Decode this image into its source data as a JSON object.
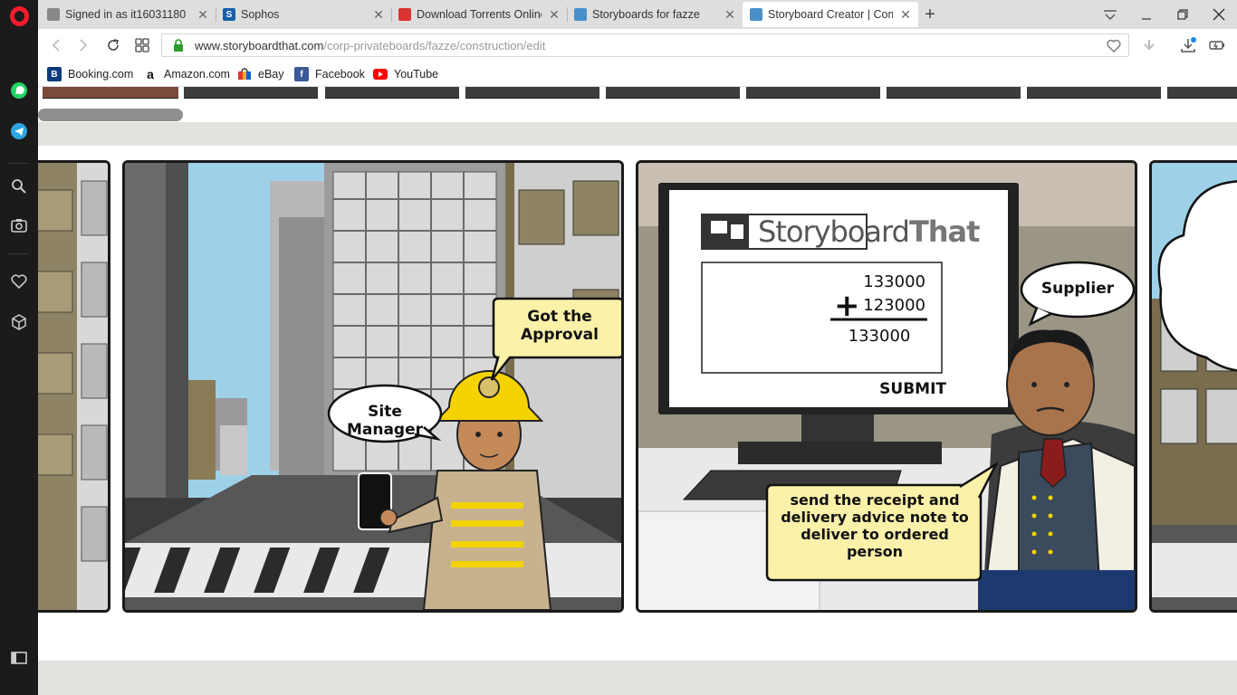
{
  "browser": {
    "tabs": [
      {
        "title": "Signed in as it16031180",
        "favicon": "doc-icon"
      },
      {
        "title": "Sophos",
        "favicon": "sophos-icon"
      },
      {
        "title": "Download Torrents Online",
        "favicon": "torrent-icon"
      },
      {
        "title": "Storyboards for fazze",
        "favicon": "storyboard-icon"
      },
      {
        "title": "Storyboard Creator | Comi",
        "favicon": "storyboard-icon",
        "active": true
      }
    ],
    "url_host": "www.storyboardthat.com",
    "url_path": "/corp-privateboards/fazze/construction/edit",
    "bookmarks": [
      {
        "label": "Booking.com",
        "icon": "B",
        "color": "#0c3b7c"
      },
      {
        "label": "Amazon.com",
        "icon": "a",
        "color": "#111111"
      },
      {
        "label": "eBay",
        "icon": "shop",
        "color": "#e53238"
      },
      {
        "label": "Facebook",
        "icon": "f",
        "color": "#3b5998"
      },
      {
        "label": "YouTube",
        "icon": "play",
        "color": "#ff0000"
      }
    ]
  },
  "storyboard": {
    "cell1": {
      "approval_bubble": "Got the Approval",
      "name_bubble": "Site Manager"
    },
    "cell2": {
      "brand_light": "Storyboard",
      "brand_bold": "That",
      "sum_line1": "133000",
      "sum_line2": "123000",
      "plus": "+",
      "sum_result": "133000",
      "submit_label": "SUBMIT",
      "name_bubble": "Supplier",
      "speech_bubble": "send the receipt and delivery advice note to deliver to ordered person"
    }
  }
}
